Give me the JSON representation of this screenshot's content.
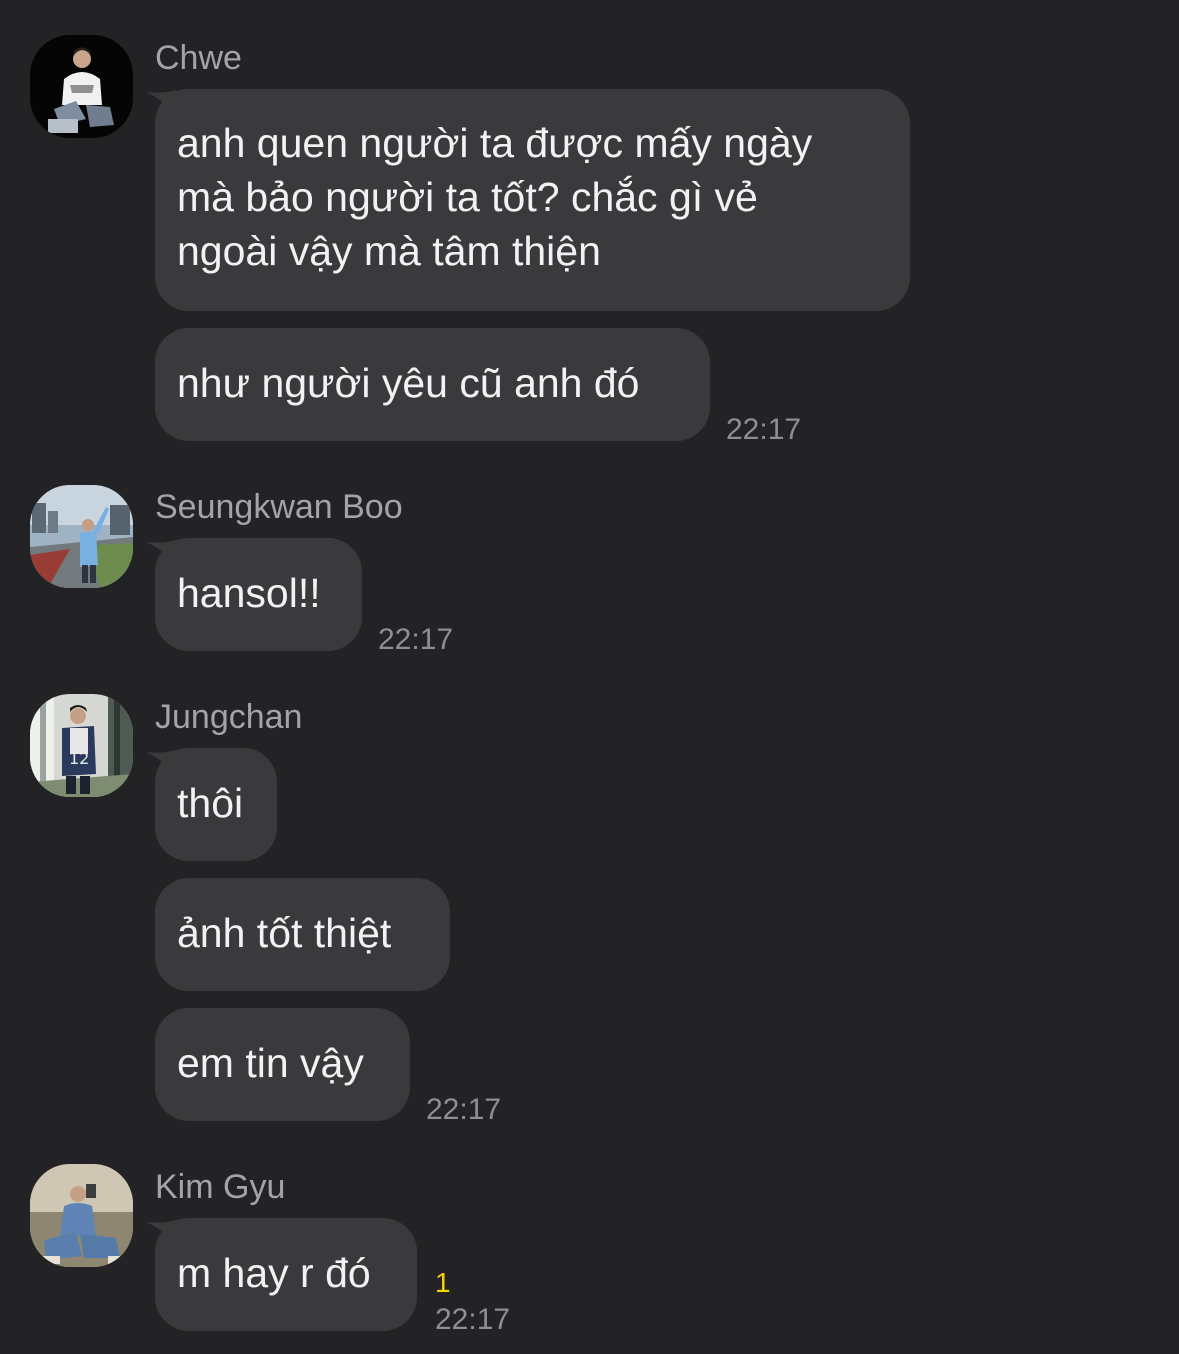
{
  "theme": {
    "background": "#232325",
    "bubble": "#3a3a3c",
    "text": "#f2f2f4",
    "meta": "#8e8e93",
    "unread": "#f4d400"
  },
  "groups": [
    {
      "sender": "Chwe",
      "avatar_icon": "avatar-photo-chwe",
      "messages": [
        "anh quen người ta được mấy ngày\nmà bảo người ta tốt? chắc gì vẻ\nngoài vậy mà tâm thiện",
        "như người yêu cũ anh đó"
      ],
      "time": "22:17"
    },
    {
      "sender": "Seungkwan Boo",
      "avatar_icon": "avatar-photo-seungkwan",
      "messages": [
        "hansol!!"
      ],
      "time": "22:17"
    },
    {
      "sender": "Jungchan",
      "avatar_icon": "avatar-photo-jungchan",
      "messages": [
        "thôi",
        "ảnh tốt thiệt",
        "em tin vậy"
      ],
      "time": "22:17"
    },
    {
      "sender": "Kim Gyu",
      "avatar_icon": "avatar-photo-kimgyu",
      "messages": [
        "m hay r đó"
      ],
      "unread_count": "1",
      "time": "22:17"
    }
  ]
}
